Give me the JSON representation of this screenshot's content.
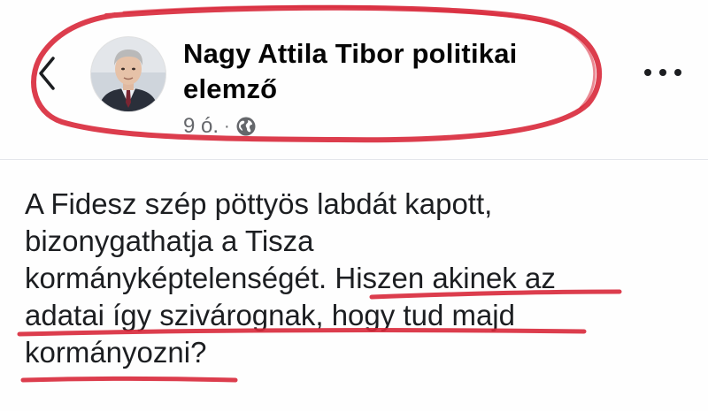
{
  "post": {
    "author_line1": "Nagy Attila Tibor politikai",
    "author_line2": "elemző",
    "time": "9 ó.",
    "separator": "·",
    "privacy_icon": "globe-icon",
    "text_lines": [
      "A Fidesz szép pöttyös labdát kapott,",
      "bizonygathatja a Tisza",
      "kormányképtelenségét. Hiszen akinek az",
      "adatai így szivárognak, hogy tud majd",
      "kormányozni?"
    ]
  },
  "icons": {
    "back": "chevron-left-icon",
    "more": "more-horizontal-icon",
    "avatar": "avatar-photo"
  },
  "colors": {
    "annotation": "#d8283a",
    "text": "#1c1e21",
    "secondary": "#65676b"
  }
}
